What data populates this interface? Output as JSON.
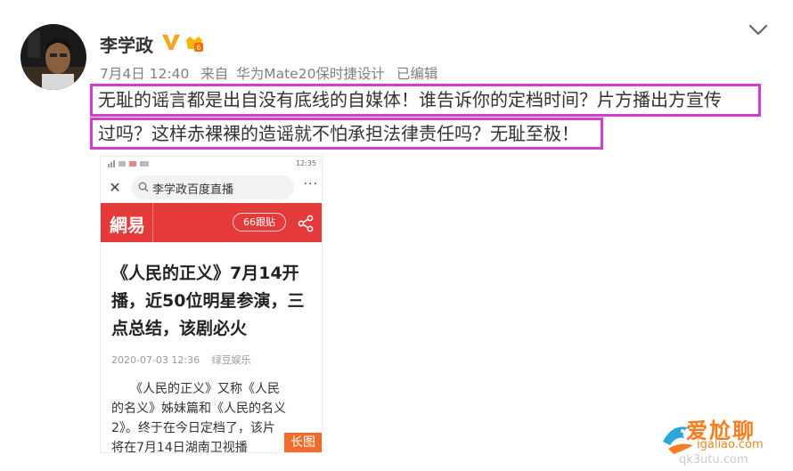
{
  "post": {
    "author": "李学政",
    "verified_icon": "verified-v-icon",
    "vip_icon": "vip-badge-icon",
    "timestamp": "7月4日 12:40",
    "source_label": "来自",
    "source_device": "华为Mate20保时捷设计",
    "edited_label": "已编辑",
    "text_line_1": "无耻的谣言都是出自没有底线的自媒体！谁告诉你的定档时间？片方播出方宣传",
    "text_line_2": "过吗？这样赤裸裸的造谣就不怕承担法律责任吗？无耻至极！",
    "highlight_color": "#d43bd1"
  },
  "embedded_screenshot": {
    "status_right": "12:35",
    "search_text": "李学政百度直播",
    "brand_logo": "網易",
    "follow_label": "66跟贴",
    "article_title": "《人民的正义》7月14开播，近50位明星参演，三点总结，该剧必火",
    "article_date": "2020-07-03 12:36",
    "article_source": "绿豆娱乐",
    "body_lines": [
      "　　《人民的正义》又称《人民",
      "的名义》姊妹篇和《人民的名义",
      "2》。终于在今日定档了，该片",
      "将在7月14日湖南卫视播"
    ],
    "long_image_tag": "长图",
    "brand_color": "#e53a3a"
  },
  "watermark": {
    "title": "爱尬聊",
    "url": "igaliao.com",
    "url2": "qk3utu.com"
  }
}
